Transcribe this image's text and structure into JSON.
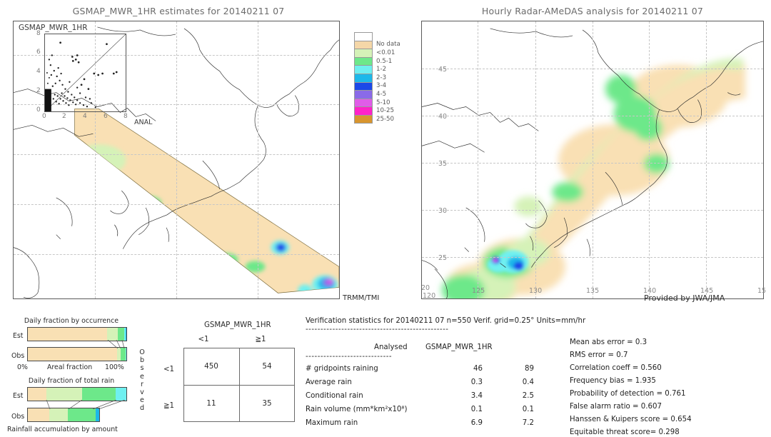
{
  "left_panel": {
    "title": "GSMAP_MWR_1HR estimates for 20140211 07",
    "inset_label": "GSMAP_MWR_1HR",
    "inset_x_label": "ANAL",
    "inset_y_ticks": [
      "8",
      "6",
      "4",
      "2",
      "0"
    ],
    "inset_x_ticks": [
      "0",
      "2",
      "4",
      "6",
      "8"
    ],
    "source_label": "TRMM/TMI"
  },
  "right_panel": {
    "title": "Hourly Radar-AMeDAS analysis for 20140211 07",
    "credit": "Provided by JWA/JMA",
    "lat_ticks": [
      "45",
      "40",
      "35",
      "30",
      "25",
      "20"
    ],
    "lon_ticks": [
      "120",
      "125",
      "130",
      "135",
      "140",
      "145",
      "15"
    ]
  },
  "colorbar": {
    "bands": [
      {
        "label": "",
        "color": "#ffffff"
      },
      {
        "label": "No data",
        "color": "#f5d7a8"
      },
      {
        "label": "<0.01",
        "color": "#d5f2b8"
      },
      {
        "label": "0.5-1",
        "color": "#6de88a"
      },
      {
        "label": "1-2",
        "color": "#6ff0f0"
      },
      {
        "label": "2-3",
        "color": "#1cb8ea"
      },
      {
        "label": "3-4",
        "color": "#1b48e8"
      },
      {
        "label": "4-5",
        "color": "#8a6ae8"
      },
      {
        "label": "5-10",
        "color": "#e05ce8"
      },
      {
        "label": "10-25",
        "color": "#ff22c8"
      },
      {
        "label": "25-50",
        "color": "#d8952e"
      }
    ]
  },
  "occurrence_chart": {
    "title": "Daily fraction by occurrence",
    "axis_label": "Areal fraction",
    "axis_min_label": "0%",
    "axis_max_label": "100%",
    "rows": [
      {
        "label": "Est",
        "segments": [
          {
            "color": "#f9e0b4",
            "pct": 80.5
          },
          {
            "color": "#d5f2b8",
            "pct": 10.5
          },
          {
            "color": "#6de88a",
            "pct": 7.0
          },
          {
            "color": "#6ff0f0",
            "pct": 1.4
          },
          {
            "color": "#1cb8ea",
            "pct": 0.6
          }
        ]
      },
      {
        "label": "Obs",
        "segments": [
          {
            "color": "#f9e0b4",
            "pct": 90.5
          },
          {
            "color": "#d5f2b8",
            "pct": 3.5
          },
          {
            "color": "#6de88a",
            "pct": 5.0
          },
          {
            "color": "#6ff0f0",
            "pct": 1.0
          }
        ]
      }
    ]
  },
  "totalrain_chart": {
    "title": "Daily fraction of total rain",
    "axis_label": "Rainfall accumulation by amount",
    "rows": [
      {
        "label": "Est",
        "width_pct": 100,
        "segments": [
          {
            "color": "#f9e0b4",
            "pct": 19.0
          },
          {
            "color": "#d5f2b8",
            "pct": 36.0
          },
          {
            "color": "#6de88a",
            "pct": 34.0
          },
          {
            "color": "#6ff0f0",
            "pct": 11.0
          }
        ]
      },
      {
        "label": "Obs",
        "width_pct": 73,
        "segments": [
          {
            "color": "#f9e0b4",
            "pct": 30.0
          },
          {
            "color": "#d5f2b8",
            "pct": 26.0
          },
          {
            "color": "#6de88a",
            "pct": 39.0
          },
          {
            "color": "#1cb8ea",
            "pct": 5.0
          }
        ]
      }
    ]
  },
  "contingency": {
    "title": "GSMAP_MWR_1HR",
    "col_headers": [
      "<1",
      "≧1"
    ],
    "row_headers": [
      "<1",
      "≧1"
    ],
    "observed_label": "Observed",
    "cells": [
      [
        "450",
        "54"
      ],
      [
        "11",
        "35"
      ]
    ]
  },
  "stats": {
    "header": "Verification statistics for 20140211 07  n=550  Verif. grid=0.25°  Units=mm/hr",
    "divider": "------------------------------------------------",
    "sub_divider": "-----------------------------",
    "col_analysed": "Analysed",
    "col_model": "GSMAP_MWR_1HR",
    "rows": [
      {
        "name": "# gridpoints raining",
        "analysed": "46",
        "model": "89"
      },
      {
        "name": "Average rain",
        "analysed": "0.3",
        "model": "0.4"
      },
      {
        "name": "Conditional rain",
        "analysed": "3.4",
        "model": "2.5"
      },
      {
        "name": "Rain volume (mm*km²x10⁸)",
        "analysed": "0.1",
        "model": "0.1"
      },
      {
        "name": "Maximum rain",
        "analysed": "6.9",
        "model": "7.2"
      }
    ],
    "scores": [
      "Mean abs error = 0.3",
      "RMS error = 0.7",
      "Correlation coeff = 0.560",
      "Frequency bias = 1.935",
      "Probability of detection = 0.761",
      "False alarm ratio = 0.607",
      "Hanssen & Kuipers score = 0.654",
      "Equitable threat score= 0.298"
    ]
  }
}
